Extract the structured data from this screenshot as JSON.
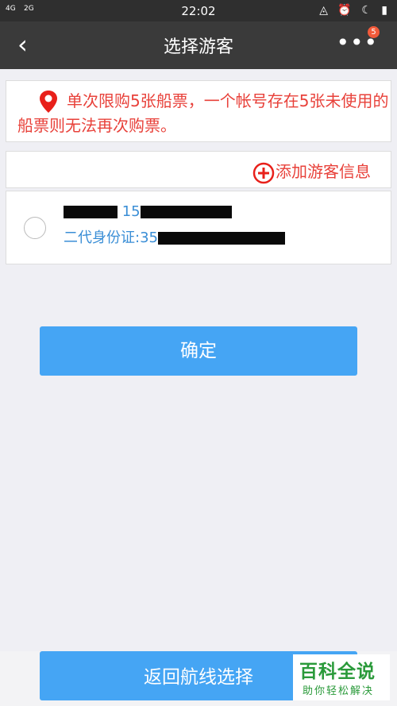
{
  "status": {
    "time": "22:02",
    "net1": "4G",
    "net2": "2G",
    "icons": "◬ ⏰ ☾ ▮"
  },
  "nav": {
    "back_icon": "chevron-left-icon",
    "title": "选择游客",
    "more_icon": "more-dots-icon",
    "badge": "5"
  },
  "notice": {
    "icon": "location-pin-icon",
    "text": "单次限购5张船票，一个帐号存在5张未使用的船票则无法再次购票。"
  },
  "add_visitor": {
    "icon": "plus-circle-icon",
    "label": "添加游客信息"
  },
  "visitor": {
    "phone_visible": "15",
    "id_prefix": "二代身份证:35",
    "selected": false
  },
  "confirm_label": "确定",
  "back_route_label": "返回航线选择",
  "watermark": {
    "title": "百科全说",
    "subtitle": "助你轻松解决"
  },
  "colors": {
    "accent": "#45a5f4",
    "warning": "#e8413a",
    "link": "#3a8ed6",
    "nav": "#3a3a3a"
  }
}
